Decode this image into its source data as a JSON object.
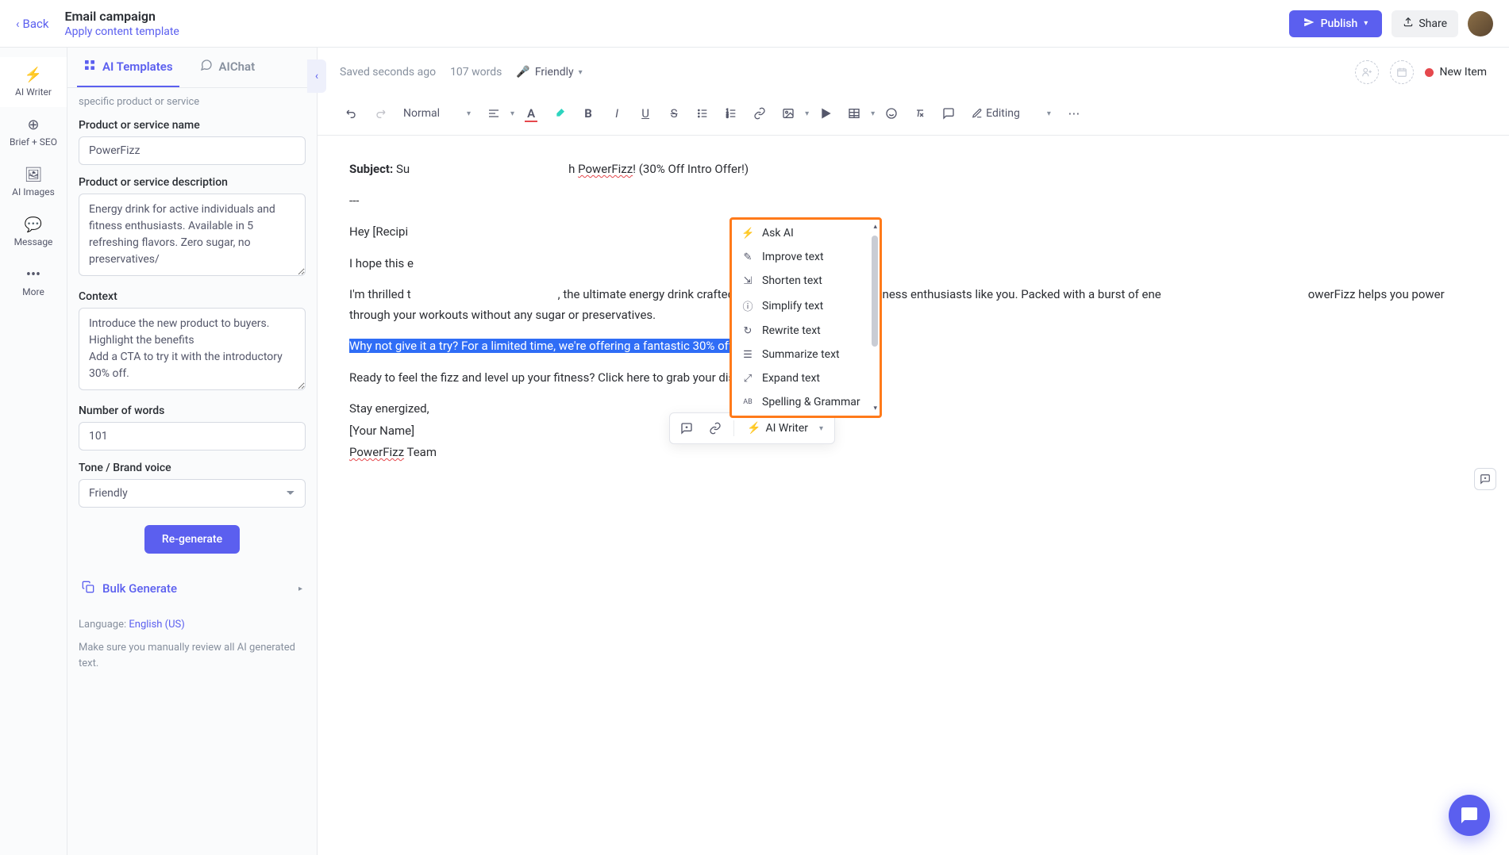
{
  "header": {
    "back": "Back",
    "title": "Email campaign",
    "subtitle": "Apply content template",
    "publish": "Publish",
    "share": "Share"
  },
  "rail": {
    "ai_writer": "AI Writer",
    "brief_seo": "Brief + SEO",
    "ai_images": "AI Images",
    "message": "Message",
    "more": "More"
  },
  "sidebar": {
    "tabs": {
      "templates": "AI Templates",
      "chat": "AIChat"
    },
    "hint": "specific product or service",
    "labels": {
      "product_name": "Product or service name",
      "product_desc": "Product or service description",
      "context": "Context",
      "num_words": "Number of words",
      "tone": "Tone / Brand voice"
    },
    "values": {
      "product_name": "PowerFizz",
      "product_desc": "Energy drink for active individuals and fitness enthusiasts. Available in 5 refreshing flavors. Zero sugar, no preservatives/",
      "context": "Introduce the new product to buyers.\nHighlight the benefits\nAdd a CTA to try it with the introductory 30% off.",
      "num_words": "101",
      "tone": "Friendly"
    },
    "regenerate": "Re-generate",
    "bulk": "Bulk Generate",
    "language_label": "Language:",
    "language_value": "English (US)",
    "review_note": "Make sure you manually review all AI generated text."
  },
  "editor_top": {
    "saved": "Saved seconds ago",
    "words": "107 words",
    "tone": "Friendly",
    "status": "New Item"
  },
  "toolbar": {
    "style": "Normal",
    "mode": "Editing"
  },
  "doc": {
    "subject_label": "Subject:",
    "subject_pre": "Su",
    "subject_mid": "h ",
    "subject_link": "PowerFizz",
    "subject_post": "! (30% Off Intro Offer!)",
    "divider": "---",
    "greeting": "Hey [Recipi",
    "hope": "I hope this e",
    "thrilled_a": "I'm thrilled t",
    "thrilled_b": ", the ultimate energy drink crafted for active individuals and fitness enthusiasts like you. Packed with a burst of ene",
    "thrilled_c": "owerFizz helps you power through your workouts without any sugar or preservatives.",
    "cta": "Why not give it a try? For a limited time, we're offering a fantastic 30% off your first order.",
    "ready": "Ready to feel the fizz and level up your fitness? Click here to grab your discount and get started!",
    "signoff1": "Stay energized,",
    "signoff2": "[Your Name]",
    "signoff3a": "PowerFizz",
    "signoff3b": " Team"
  },
  "float": {
    "ai_writer": "AI Writer"
  },
  "ai_menu": {
    "items": [
      "Ask AI",
      "Improve text",
      "Shorten text",
      "Simplify text",
      "Rewrite text",
      "Summarize text",
      "Expand text",
      "Spelling & Grammar"
    ]
  }
}
